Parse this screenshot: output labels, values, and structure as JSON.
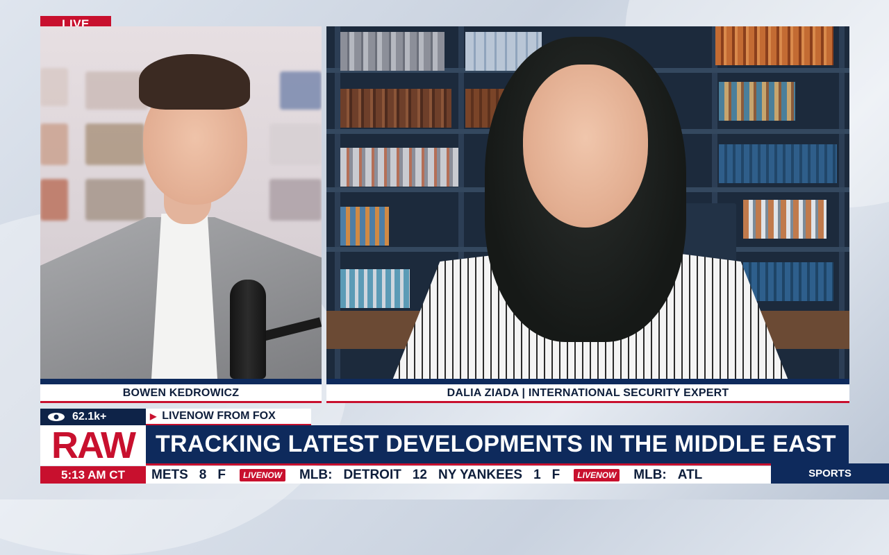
{
  "live_label": "LIVE",
  "left_feed": {
    "name": "BOWEN KEDROWICZ"
  },
  "right_feed": {
    "name": "DALIA ZIADA | INTERNATIONAL SECURITY EXPERT"
  },
  "lower_third": {
    "viewers": "62.1k+",
    "source": "LIVENOW FROM FOX",
    "brand": "RAW",
    "headline": "TRACKING LATEST DEVELOPMENTS IN THE MIDDLE EAST",
    "time": "5:13 AM CT",
    "ticker": [
      "METS",
      "8",
      "F",
      "LIVENOW",
      "MLB:",
      "DETROIT",
      "12",
      "NY YANKEES",
      "1",
      "F",
      "LIVENOW",
      "MLB:",
      "ATL"
    ],
    "ticker_category": "SPORTS"
  },
  "colors": {
    "accent_red": "#c8102e",
    "navy": "#0e2a5c"
  },
  "icons": {
    "viewers": "eye-icon"
  }
}
